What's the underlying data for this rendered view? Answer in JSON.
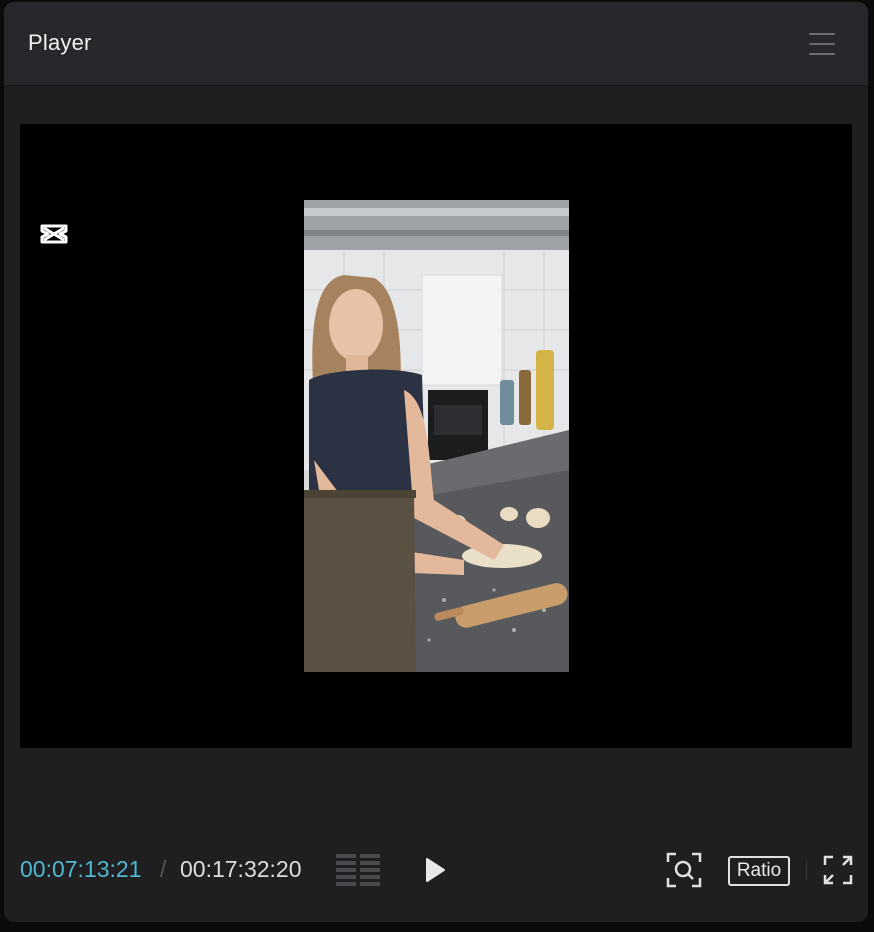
{
  "panel": {
    "title": "Player",
    "menu_icon": "hamburger-menu-icon"
  },
  "viewport": {
    "watermark_icon": "capcut-logo-icon",
    "video_description_icon": "video-frame"
  },
  "controls": {
    "current_time": "00:07:13:21",
    "separator": "/",
    "total_time": "00:17:32:20",
    "grid_icon": "waveform-grid-icon",
    "play_icon": "play-icon",
    "zoom_icon": "zoom-fit-icon",
    "ratio_label": "Ratio",
    "fullscreen_icon": "fullscreen-icon"
  },
  "colors": {
    "accent_time": "#4fb7cf",
    "panel_bg": "#1f1f22",
    "header_bg": "#28282c"
  }
}
